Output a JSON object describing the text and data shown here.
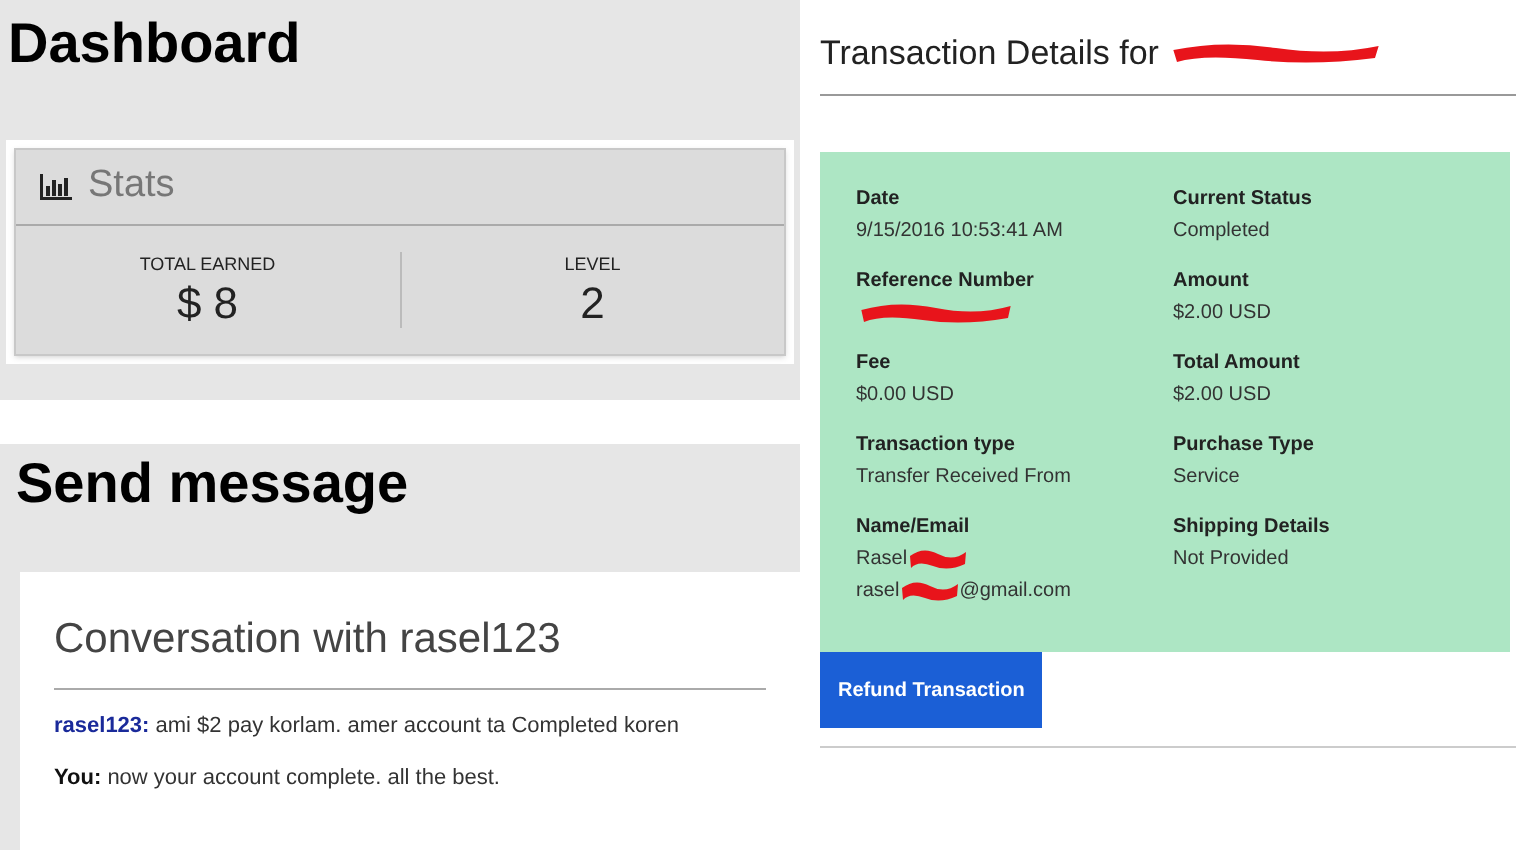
{
  "dashboard": {
    "heading": "Dashboard",
    "stats": {
      "title": "Stats",
      "items": [
        {
          "label": "TOTAL EARNED",
          "value": "$ 8"
        },
        {
          "label": "LEVEL",
          "value": "2"
        }
      ]
    }
  },
  "send_message": {
    "heading": "Send message",
    "conversation_title": "Conversation with rasel123",
    "messages": [
      {
        "sender": "rasel123:",
        "color": "#1a2a9a",
        "text": "ami $2 pay korlam. amer account ta Completed koren"
      },
      {
        "sender": "You:",
        "color": "#111111",
        "text": "now your account complete. all the best."
      }
    ]
  },
  "transaction": {
    "title": [
      {
        "kind": "text",
        "text": "Transaction Details for"
      },
      {
        "kind": "redacted"
      }
    ],
    "fields": [
      {
        "label": "Date",
        "lines": [
          [
            {
              "kind": "text",
              "text": "9/15/2016 10:53:41 AM"
            }
          ]
        ]
      },
      {
        "label": "Current Status",
        "lines": [
          [
            {
              "kind": "text",
              "text": "Completed"
            }
          ]
        ]
      },
      {
        "label": "Reference Number",
        "lines": [
          [
            {
              "kind": "redacted"
            }
          ]
        ]
      },
      {
        "label": "Amount",
        "lines": [
          [
            {
              "kind": "text",
              "text": "$2.00 USD"
            }
          ]
        ]
      },
      {
        "label": "Fee",
        "lines": [
          [
            {
              "kind": "text",
              "text": "$0.00 USD"
            }
          ]
        ]
      },
      {
        "label": "Total Amount",
        "lines": [
          [
            {
              "kind": "text",
              "text": "$2.00 USD"
            }
          ]
        ]
      },
      {
        "label": "Transaction type",
        "lines": [
          [
            {
              "kind": "text",
              "text": "Transfer Received From"
            }
          ]
        ]
      },
      {
        "label": "Purchase Type",
        "lines": [
          [
            {
              "kind": "text",
              "text": "Service"
            }
          ]
        ]
      },
      {
        "label": "Name/Email",
        "lines": [
          [
            {
              "kind": "text",
              "text": "Rasel"
            },
            {
              "kind": "redacted"
            }
          ],
          [
            {
              "kind": "text",
              "text": "rasel"
            },
            {
              "kind": "redacted"
            },
            {
              "kind": "text",
              "text": "@gmail.com"
            }
          ]
        ]
      },
      {
        "label": "Shipping Details",
        "lines": [
          [
            {
              "kind": "text",
              "text": "Not Provided"
            }
          ]
        ]
      }
    ],
    "button": "Refund Transaction"
  }
}
